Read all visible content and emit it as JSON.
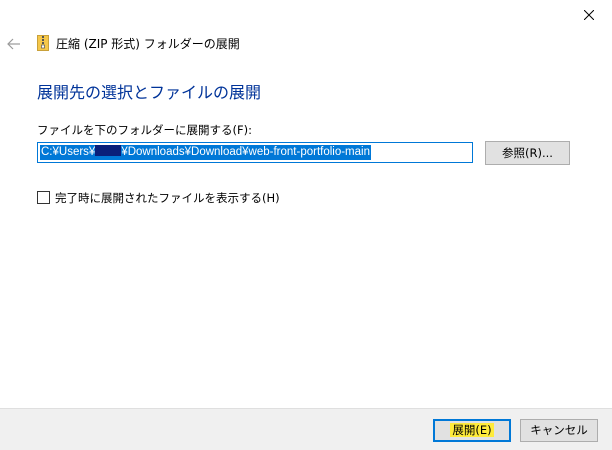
{
  "window": {
    "close_icon": "close-icon"
  },
  "header": {
    "back_icon": "back-arrow-icon",
    "app_icon": "zip-folder-icon",
    "title": "圧縮 (ZIP 形式) フォルダーの展開"
  },
  "main": {
    "heading": "展開先の選択とファイルの展開",
    "destination_label": "ファイルを下のフォルダーに展開する(F):",
    "path": {
      "prefix": "C:¥Users¥",
      "suffix": "¥Downloads¥Download¥web-front-portfolio-main"
    },
    "browse_label": "参照(R)...",
    "show_files_checkbox": {
      "label": "完了時に展開されたファイルを表示する(H)",
      "checked": false
    }
  },
  "footer": {
    "extract_label": "展開(E)",
    "cancel_label": "キャンセル"
  },
  "colors": {
    "heading": "#003399",
    "accent": "#0078d7",
    "highlight": "#ffeb3b",
    "footer_bg": "#f0f0f0"
  }
}
